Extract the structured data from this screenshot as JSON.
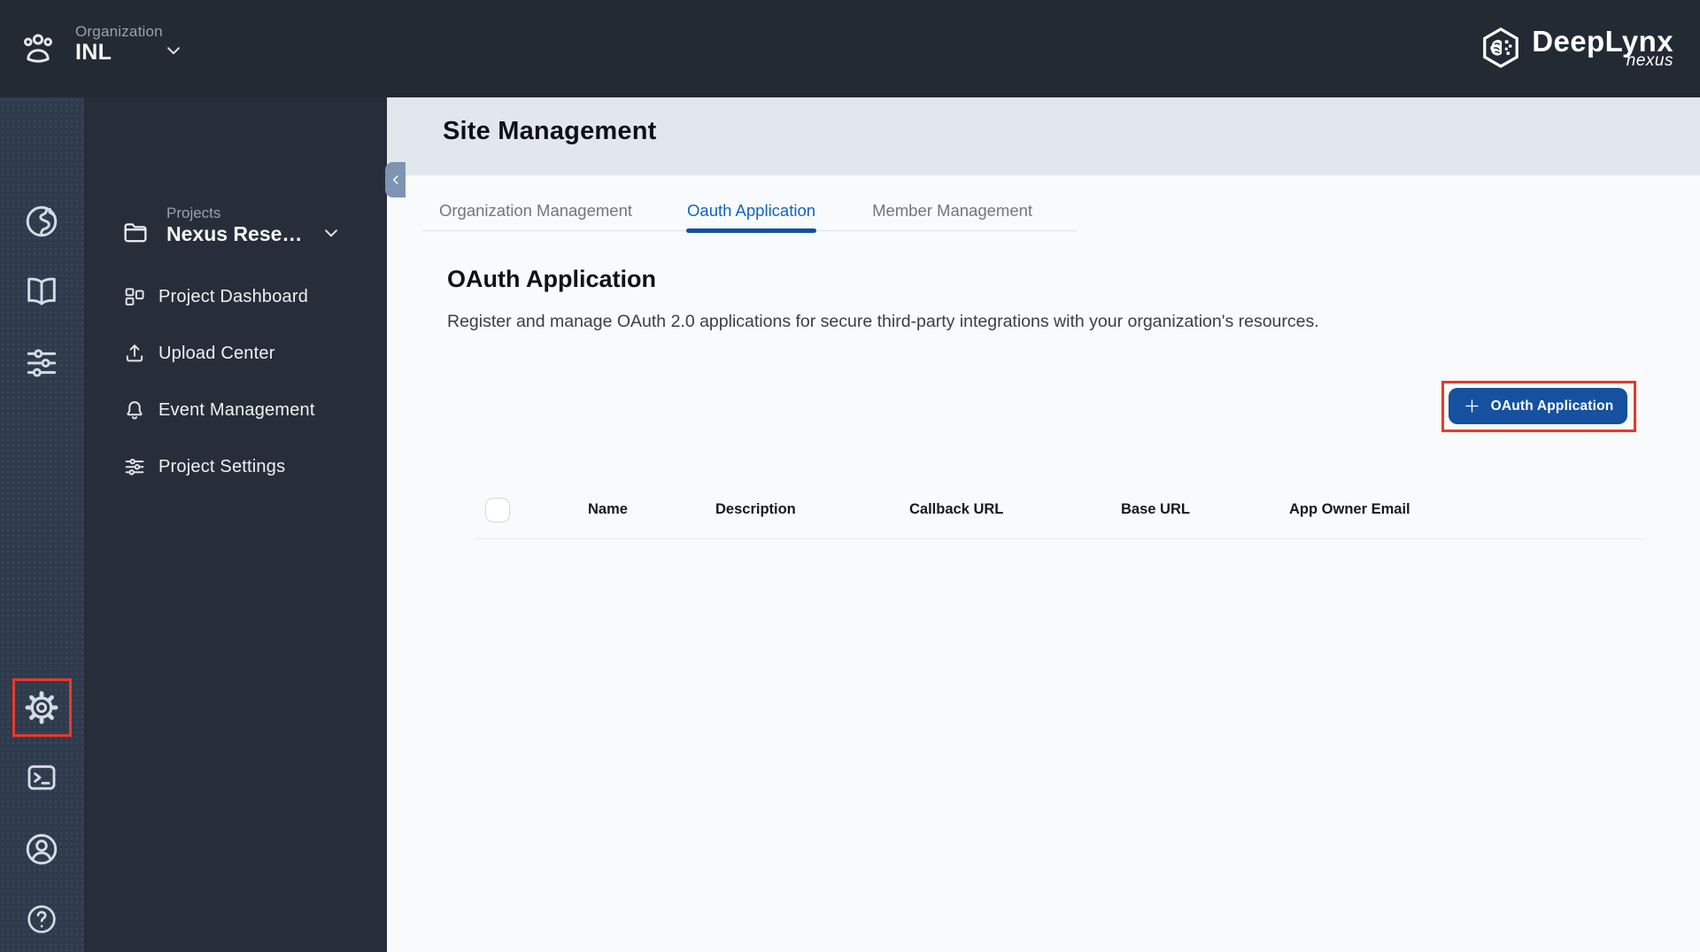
{
  "topbar": {
    "organization_label": "Organization",
    "organization_name": "INL",
    "logo_text": "DeepLynx",
    "logo_subtext": "nexus"
  },
  "rail": {
    "icons": [
      "globe-icon",
      "book-icon",
      "equalizer-icon",
      "gear-icon",
      "terminal-icon",
      "account-icon",
      "help-icon"
    ]
  },
  "sidebar": {
    "projects_label": "Projects",
    "project_name": "Nexus Rese…",
    "menu_items": [
      {
        "icon": "dashboard-icon",
        "label": "Project Dashboard"
      },
      {
        "icon": "upload-icon",
        "label": "Upload Center"
      },
      {
        "icon": "bell-icon",
        "label": "Event Management"
      },
      {
        "icon": "tune-icon",
        "label": "Project Settings"
      }
    ]
  },
  "main": {
    "page_title": "Site Management",
    "tabs": [
      {
        "label": "Organization Management",
        "active": false
      },
      {
        "label": "Oauth Application",
        "active": true
      },
      {
        "label": "Member Management",
        "active": false
      }
    ],
    "section_title": "OAuth Application",
    "section_description": "Register and manage OAuth 2.0 applications for secure third-party integrations with your organization's resources.",
    "add_button": {
      "icon": "plus-icon",
      "label": "OAuth Application"
    },
    "table": {
      "headers": [
        "Name",
        "Description",
        "Callback URL",
        "Base URL",
        "App Owner Email"
      ],
      "rows": []
    }
  },
  "annotations": {
    "highlight_color": "#e8392a",
    "highlighted_elements": [
      "settings-rail-button",
      "add-oauth-application-button"
    ]
  },
  "colors": {
    "topbar_bg": "#232a34",
    "rail_bg": "#2e3b4d",
    "sidebar_bg": "#272e39",
    "band_bg": "#e2e7ee",
    "content_bg": "#f8fafb",
    "tab_active_text": "#1064c0",
    "tab_underline": "#11519f",
    "button_bg": "#15519f",
    "highlight_red": "#e8392a"
  }
}
